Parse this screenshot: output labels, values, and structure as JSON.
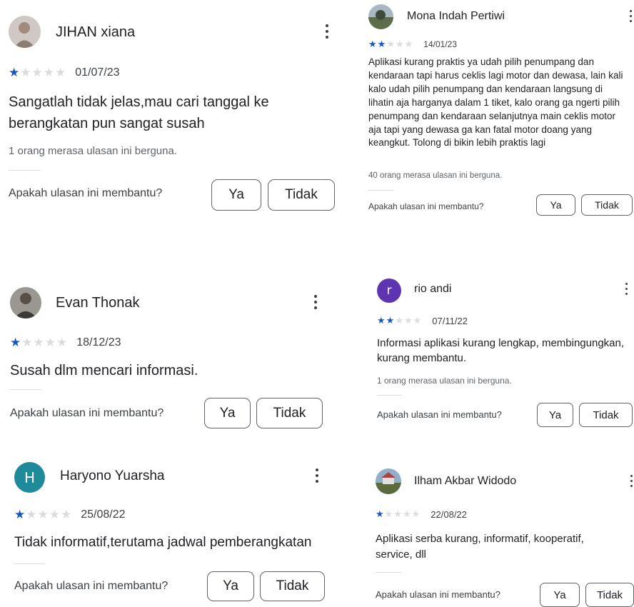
{
  "reviews": [
    {
      "name": "JIHAN xiana",
      "stars": 1,
      "date": "01/07/23",
      "text": "Sangatlah tidak jelas,mau cari tanggal ke berangkatan pun sangat susah",
      "helpful": "1 orang merasa ulasan ini berguna.",
      "ask": "Apakah ulasan ini membantu?",
      "yes": "Ya",
      "no": "Tidak",
      "avatar": {
        "type": "photo",
        "bg": "#c9c3c0",
        "fg": "#8a7d74"
      }
    },
    {
      "name": "Mona Indah Pertiwi",
      "stars": 2,
      "date": "14/01/23",
      "text": "Aplikasi kurang praktis ya udah pilih penumpang dan kendaraan tapi harus ceklis lagi motor dan dewasa, lain kali kalo udah pilih penumpang dan kendaraan langsung di lihatin aja harganya dalam 1 tiket, kalo orang ga ngerti pilih penumpang dan kendaraan selanjutnya main ceklis motor aja tapi yang dewasa ga kan fatal motor doang yang keangkut. Tolong di bikin lebih praktis lagi",
      "helpful": "40 orang merasa ulasan ini berguna.",
      "ask": "Apakah ulasan ini membantu?",
      "yes": "Ya",
      "no": "Tidak",
      "avatar": {
        "type": "photo",
        "bg": "#7d8c6e",
        "fg": "#3f4a3a"
      }
    },
    {
      "name": "Evan Thonak",
      "stars": 1,
      "date": "18/12/23",
      "text": "Susah dlm mencari informasi.",
      "helpful": "",
      "ask": "Apakah ulasan ini membantu?",
      "yes": "Ya",
      "no": "Tidak",
      "avatar": {
        "type": "photo",
        "bg": "#8d8a86",
        "fg": "#3b3a39"
      }
    },
    {
      "name": "rio andi",
      "stars": 2,
      "date": "07/11/22",
      "text": "Informasi aplikasi kurang lengkap, membingungkan, kurang membantu.",
      "helpful": "1 orang merasa ulasan ini berguna.",
      "ask": "Apakah ulasan ini membantu?",
      "yes": "Ya",
      "no": "Tidak",
      "avatar": {
        "type": "letter",
        "letter": "r",
        "bg": "#5e35b1"
      }
    },
    {
      "name": "Haryono Yuarsha",
      "stars": 1,
      "date": "25/08/22",
      "text": "Tidak informatif,terutama jadwal pemberangkatan",
      "helpful": "",
      "ask": "Apakah ulasan ini membantu?",
      "yes": "Ya",
      "no": "Tidak",
      "avatar": {
        "type": "letter",
        "letter": "H",
        "bg": "#1e8a9a"
      }
    },
    {
      "name": "Ilham Akbar Widodo",
      "stars": 1,
      "date": "22/08/22",
      "text": "Aplikasi serba kurang, informatif, kooperatif, service, dll",
      "helpful": "",
      "ask": "Apakah ulasan ini membantu?",
      "yes": "Ya",
      "no": "Tidak",
      "avatar": {
        "type": "photo",
        "bg": "#6d8fa8",
        "fg": "#5b6b3e"
      }
    }
  ],
  "colors": {
    "star_filled": "#1a56c4",
    "star_empty": "#dadce0",
    "border": "#5f6368"
  }
}
